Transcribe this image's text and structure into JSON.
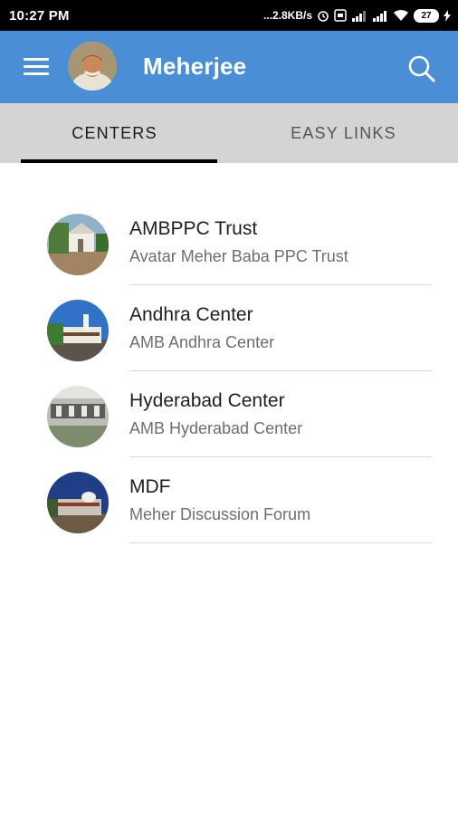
{
  "status_bar": {
    "time": "10:27 PM",
    "net_speed": "...2.8KB/s",
    "battery": "27"
  },
  "app_bar": {
    "title": "Meherjee"
  },
  "tabs": [
    {
      "label": "CENTERS",
      "active": true
    },
    {
      "label": "EASY LINKS",
      "active": false
    }
  ],
  "centers": [
    {
      "title": "AMBPPC Trust",
      "subtitle": "Avatar Meher Baba PPC Trust"
    },
    {
      "title": "Andhra Center",
      "subtitle": "AMB Andhra Center"
    },
    {
      "title": "Hyderabad Center",
      "subtitle": "AMB Hyderabad Center"
    },
    {
      "title": "MDF",
      "subtitle": "Meher Discussion Forum"
    }
  ],
  "colors": {
    "app_bar": "#4a8fd6",
    "tab_strip": "#d4d4d4",
    "indicator": "#000000"
  }
}
